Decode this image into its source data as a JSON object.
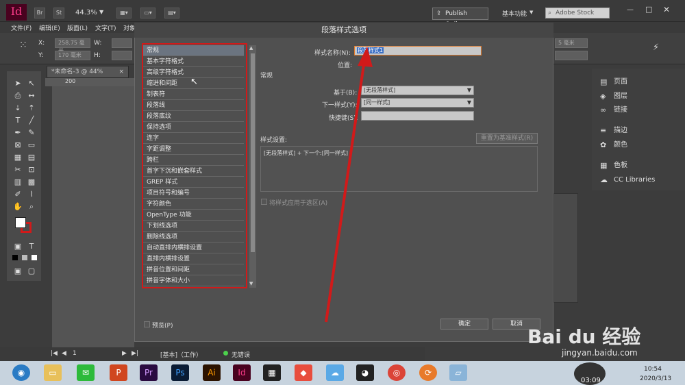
{
  "app": {
    "logo": "Id",
    "zoom": "44.3%",
    "publish": "Publish Online",
    "workspace": "基本功能",
    "stock_placeholder": "Adobe Stock"
  },
  "menu": [
    "文件(F)",
    "编辑(E)",
    "版面(L)",
    "文字(T)",
    "对象"
  ],
  "control": {
    "x_label": "X:",
    "y_label": "Y:",
    "w_label": "W:",
    "h_label": "H:",
    "x_value": "258.75 毫米",
    "y_value": "170 毫米",
    "right_value": "5 毫米"
  },
  "document": {
    "tab": "*未命名-3 @ 44%",
    "ruler_label": "200"
  },
  "right_panel": [
    {
      "icon": "▤",
      "label": "页面"
    },
    {
      "icon": "◈",
      "label": "图层"
    },
    {
      "icon": "∞",
      "label": "链接"
    },
    {
      "icon": "≡",
      "label": "描边"
    },
    {
      "icon": "✿",
      "label": "颜色"
    },
    {
      "icon": "▦",
      "label": "色板"
    },
    {
      "icon": "☁",
      "label": "CC Libraries"
    }
  ],
  "dialog": {
    "title": "段落样式选项",
    "style_name_label": "样式名称(N):",
    "style_name_value": "段落样式1",
    "position_label": "位置:",
    "section_title": "常规",
    "based_on_label": "基于(B):",
    "based_on_value": "[无段落样式]",
    "next_style_label": "下一样式(Y):",
    "next_style_value": "[同一样式]",
    "shortcut_label": "快捷键(S):",
    "settings_label": "样式设置:",
    "reset_button": "重置为基准样式(R)",
    "settings_text": "[无段落样式] + 下一个:[同一样式]",
    "apply_label": "将样式应用于选区(A)",
    "preview_label": "预览(P)",
    "ok": "确定",
    "cancel": "取消",
    "categories": [
      "常规",
      "基本字符格式",
      "高级字符格式",
      "缩进和间距",
      "制表符",
      "段落线",
      "段落底纹",
      "保持选项",
      "连字",
      "字距调整",
      "跨栏",
      "首字下沉和嵌套样式",
      "GREP 样式",
      "项目符号和编号",
      "字符颜色",
      "OpenType 功能",
      "下划线选项",
      "删除线选项",
      "自动直排内横排设置",
      "直排内横排设置",
      "拼音位置和间距",
      "拼音字体和大小"
    ]
  },
  "status": {
    "page": "1",
    "basic": "[基本]（工作）",
    "errors": "无错误"
  },
  "taskbar": {
    "clock_time": "10:54",
    "clock_date": "2020/3/13",
    "recording": "03:09"
  },
  "watermark": {
    "brand": "Bai du 经验",
    "url": "jingyan.baidu.com"
  }
}
